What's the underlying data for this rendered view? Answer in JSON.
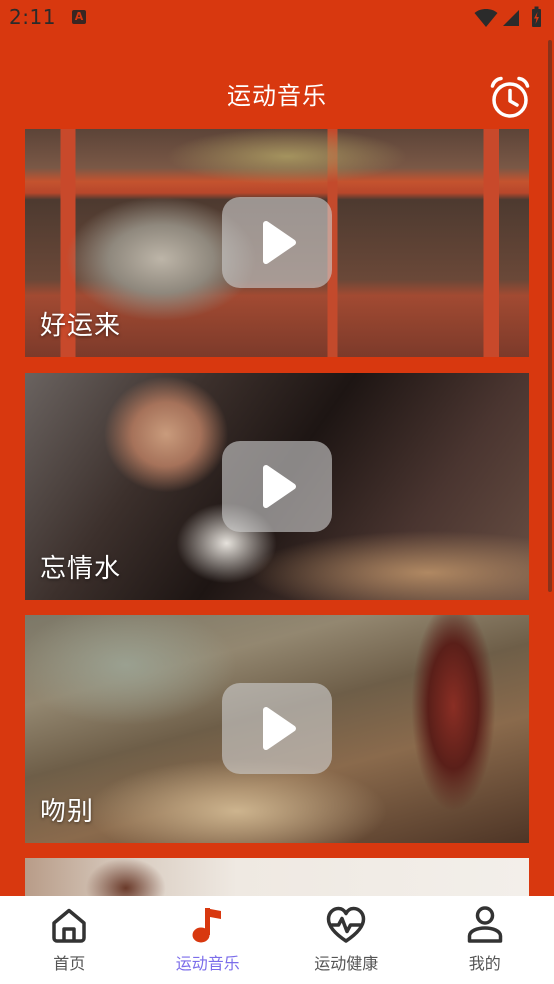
{
  "status_bar": {
    "time": "2:11",
    "notification_letter": "A",
    "icons": [
      "wifi-icon",
      "signal-icon",
      "battery-charging-icon"
    ]
  },
  "header": {
    "title": "运动音乐",
    "action_icon": "alarm-clock-icon"
  },
  "songs": [
    {
      "title": "好运来",
      "icon": "play-icon"
    },
    {
      "title": "忘情水",
      "icon": "play-icon"
    },
    {
      "title": "吻别",
      "icon": "play-icon"
    }
  ],
  "bottom_nav": {
    "items": [
      {
        "label": "首页",
        "icon": "home-icon",
        "active": false
      },
      {
        "label": "运动音乐",
        "icon": "music-note-icon",
        "active": true
      },
      {
        "label": "运动健康",
        "icon": "heart-pulse-icon",
        "active": false
      },
      {
        "label": "我的",
        "icon": "person-icon",
        "active": false
      }
    ]
  },
  "colors": {
    "primary": "#D8380F",
    "nav_active_label": "#7B6DEA",
    "nav_inactive": "#555555",
    "nav_background": "#FFFFFF"
  }
}
